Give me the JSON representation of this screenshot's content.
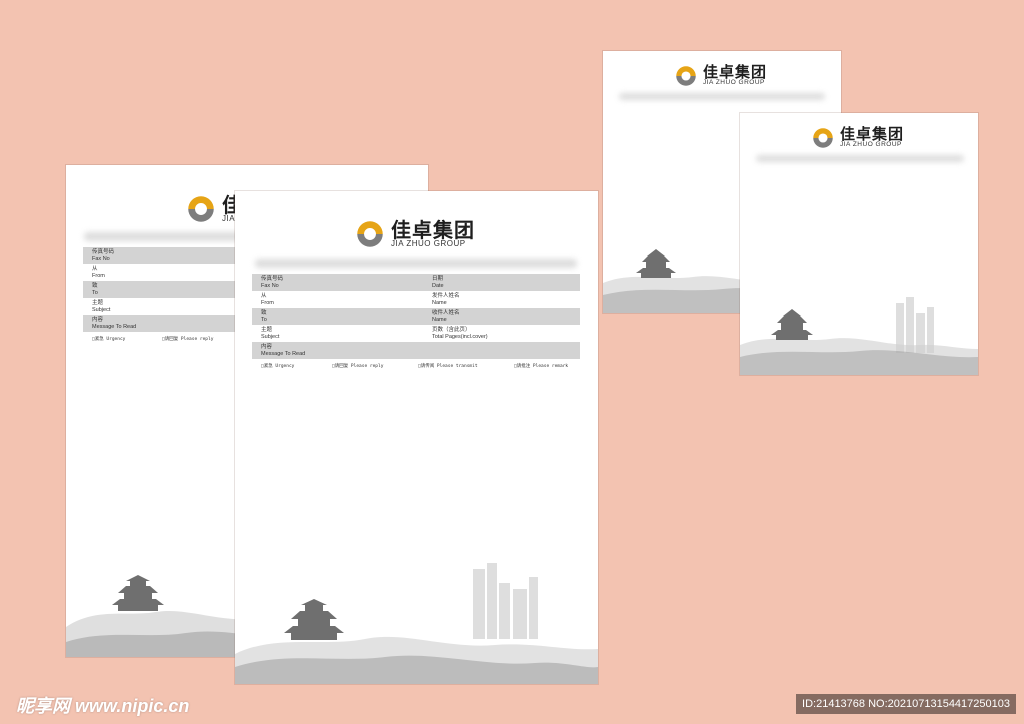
{
  "logo": {
    "cn": "佳卓集团",
    "en": "JIA ZHUO GROUP"
  },
  "form": {
    "rows": [
      {
        "left_cn": "传真号码",
        "left_en": "Fax No",
        "right_cn": "日期",
        "right_en": "Date"
      },
      {
        "left_cn": "从",
        "left_en": "From",
        "right_cn": "发件人姓名",
        "right_en": "Name"
      },
      {
        "left_cn": "致",
        "left_en": "To",
        "right_cn": "收件人姓名",
        "right_en": "Name"
      },
      {
        "left_cn": "主题",
        "left_en": "Subject",
        "right_cn": "页数（含此页）",
        "right_en": "Total Pages(incl.cover)"
      },
      {
        "left_cn": "内容",
        "left_en": "Message To Read",
        "right_cn": "",
        "right_en": ""
      }
    ],
    "checkboxes": [
      "□紧急 Urgency",
      "□请回复 Please reply",
      "□请传阅 Please transmit",
      "□请批注 Please remark"
    ]
  },
  "watermark": {
    "site": "昵享网 www.nipic.cn",
    "id": "ID:21413768 NO:20210713154417250103"
  },
  "colors": {
    "background": "#f3c3b1",
    "row_shade": "#d3d3d3",
    "logo_gold": "#e6a416",
    "logo_gray": "#7d7d7d"
  }
}
